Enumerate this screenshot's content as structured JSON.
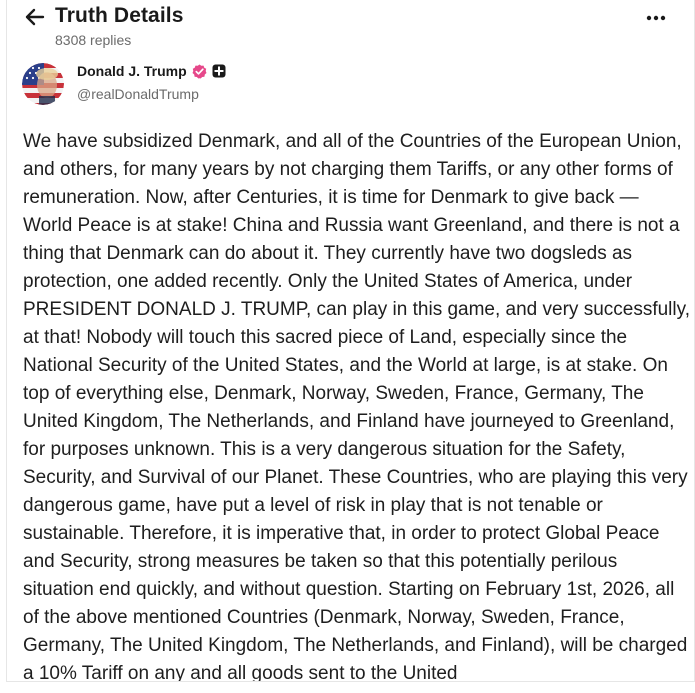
{
  "header": {
    "title": "Truth Details",
    "replies": "8308 replies",
    "back_icon": "arrow-left-icon",
    "more_icon": "more-horizontal-icon"
  },
  "author": {
    "name": "Donald J. Trump",
    "handle": "@realDonaldTrump",
    "verified_icon": "verified-badge-icon",
    "verified_color": "#e6488a",
    "plus_icon": "plus-badge-icon"
  },
  "post": {
    "text": "We have subsidized Denmark, and all of the Countries of the European Union, and others, for many years by not charging them Tariffs, or any other forms of remuneration. Now, after Centuries, it is time for Denmark to give back — World Peace is at stake! China and Russia want Greenland, and there is not a thing that Denmark can do about it. They currently have two dogsleds as protection, one added recently. Only the United States of America, under PRESIDENT DONALD J. TRUMP, can play in this game, and very successfully, at that! Nobody will touch this sacred piece of Land, especially since the National Security of the United States, and the World at large, is at stake. On top of everything else, Denmark, Norway, Sweden, France, Germany, The United Kingdom, The Netherlands, and Finland have journeyed to Greenland, for purposes unknown. This is a very dangerous situation for the Safety, Security, and Survival of our Planet. These Countries, who are playing this very dangerous game, have put a level of risk in play that is not tenable or sustainable. Therefore, it is imperative that, in order to protect Global Peace and Security, strong measures be taken so that this potentially perilous situation end quickly, and without question. Starting on February 1st, 2026, all of the above mentioned Countries (Denmark, Norway, Sweden, France, Germany, The United Kingdom, The Netherlands, and Finland), will be charged a 10% Tariff on any and all goods sent to the United"
  }
}
